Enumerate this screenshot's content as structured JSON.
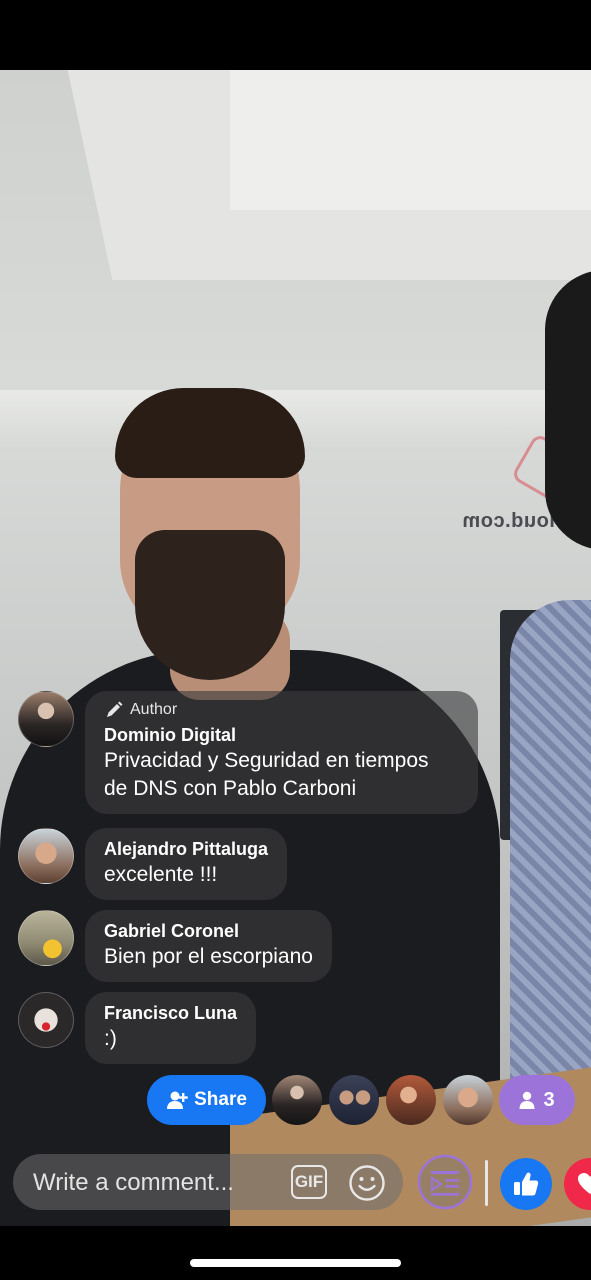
{
  "comments": [
    {
      "badge": "Author",
      "name": "Dominio Digital",
      "text_line1": "Privacidad y Seguridad en tiempos",
      "text_line2": "de DNS con Pablo Carboni"
    },
    {
      "name": "Alejandro Pittaluga",
      "text": "excelente !!!"
    },
    {
      "name": "Gabriel Coronel",
      "text": "Bien por el escorpiano"
    },
    {
      "name": "Francisco Luna",
      "text": ":)"
    }
  ],
  "share_label": "Share",
  "viewer_count": "3",
  "comment_input": {
    "placeholder": "Write a comment...",
    "value": ""
  },
  "gif_label": "GIF",
  "scene": {
    "wall_text": "cloud.com"
  },
  "icons": {
    "share": "add-person-icon",
    "viewers": "person-icon",
    "author_badge": "pencil-icon",
    "emoji": "smiley-icon",
    "video_queue": "video-queue-icon",
    "like": "thumbs-up-icon",
    "love": "heart-icon"
  },
  "colors": {
    "share_button": "#1877f2",
    "viewer_pill": "#9c74d9",
    "like": "#1877f2",
    "love": "#f0284a",
    "video_queue_ring": "#9c74d9"
  }
}
